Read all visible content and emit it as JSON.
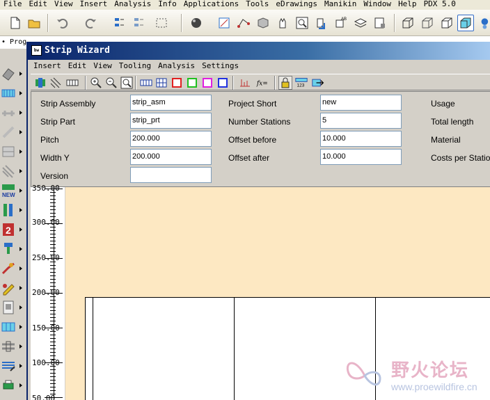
{
  "main_menu": [
    "File",
    "Edit",
    "View",
    "Insert",
    "Analysis",
    "Info",
    "Applications",
    "Tools",
    "eDrawings",
    "Manikin",
    "Window",
    "Help",
    "PDX 5.0"
  ],
  "prog_tab": "• Prog",
  "wizard": {
    "title": "Strip Wizard",
    "logo_text": "bw",
    "menu": [
      "Insert",
      "Edit",
      "View",
      "Tooling",
      "Analysis",
      "Settings"
    ],
    "fx_label": "fx=",
    "stations_icon_text": "123"
  },
  "form": {
    "strip_assembly": {
      "label": "Strip Assembly",
      "value": "strip_asm"
    },
    "strip_part": {
      "label": "Strip Part",
      "value": "strip_prt"
    },
    "pitch": {
      "label": "Pitch",
      "value": "200.000"
    },
    "width_y": {
      "label": "Width Y",
      "value": "200.000"
    },
    "version": {
      "label": "Version",
      "value": ""
    },
    "project_short": {
      "label": "Project Short",
      "value": "new"
    },
    "number_stations": {
      "label": "Number Stations",
      "value": "5"
    },
    "offset_before": {
      "label": "Offset before",
      "value": "10.000"
    },
    "offset_after": {
      "label": "Offset after",
      "value": "10.000"
    },
    "usage": {
      "label": "Usage"
    },
    "total_length": {
      "label": "Total length"
    },
    "material": {
      "label": "Material"
    },
    "costs_per_station": {
      "label": "Costs per Station"
    }
  },
  "ruler": {
    "labels": [
      "350.00",
      "300.00",
      "250.00",
      "200.00",
      "150.00",
      "100.00",
      "50.00"
    ]
  },
  "watermark": {
    "text_cn": "野火论坛",
    "url": "www.proewildfire.cn"
  },
  "colors": {
    "canvas": "#fde8c2",
    "title_bar": "#0a246a"
  }
}
